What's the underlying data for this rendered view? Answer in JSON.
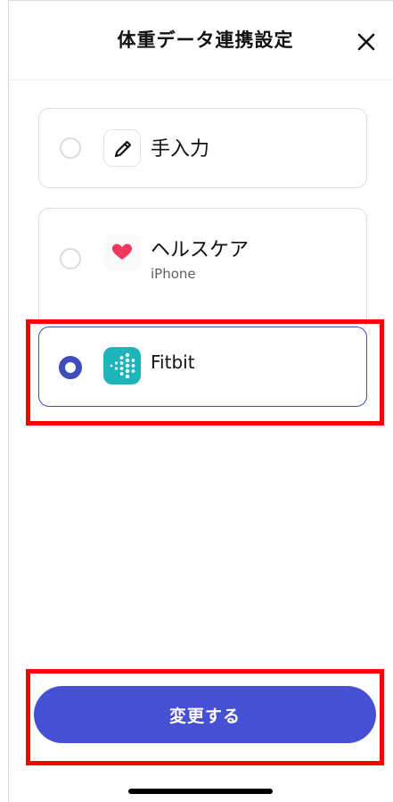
{
  "header": {
    "title": "体重データ連携設定",
    "close_icon": "close-icon"
  },
  "options": [
    {
      "label": "手入力",
      "sublabel": "",
      "icon": "pencil-icon",
      "selected": false
    },
    {
      "label": "ヘルスケア",
      "sublabel": "iPhone",
      "icon": "heart-icon",
      "selected": false
    },
    {
      "label": "Fitbit",
      "sublabel": "",
      "icon": "fitbit-icon",
      "selected": true
    }
  ],
  "footer": {
    "submit_label": "変更する"
  },
  "colors": {
    "accent": "#4550d2",
    "selected_border": "#3e4db9",
    "highlight": "#ff0000",
    "fitbit": "#1fb4ba",
    "heart": "#f2375d"
  }
}
